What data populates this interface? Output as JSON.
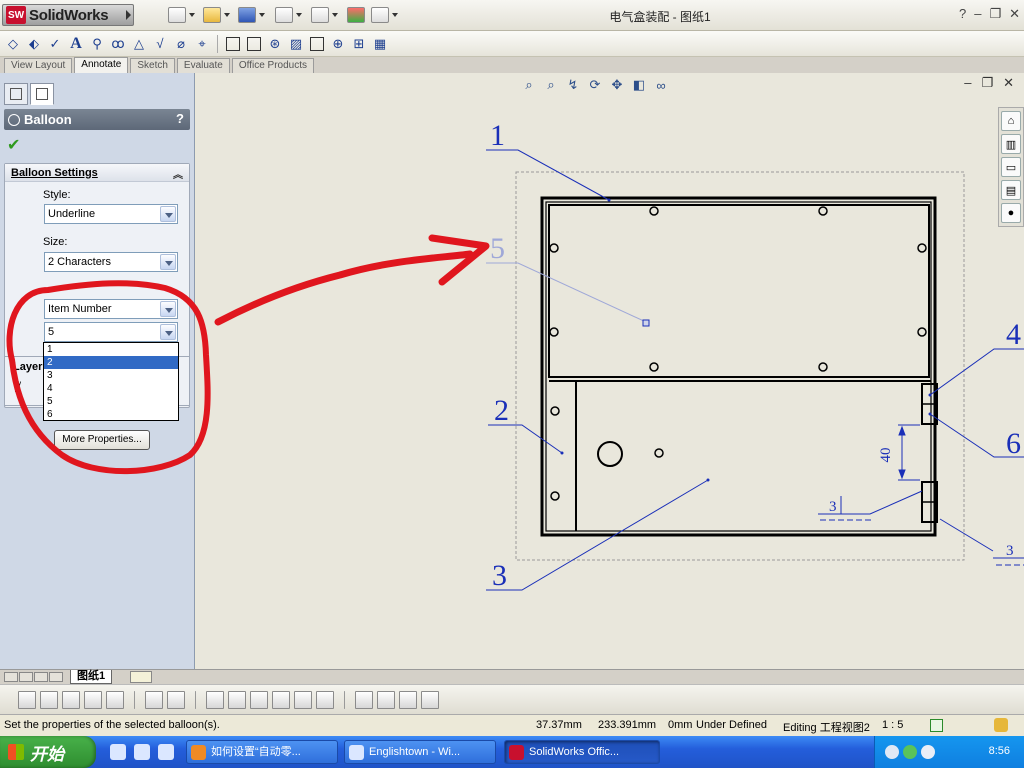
{
  "app": {
    "brand": "SolidWorks",
    "document_title": "电气盒装配 - 图纸1",
    "help": "?",
    "minimize": "–",
    "restore": "❐",
    "close": "✕"
  },
  "command_tabs": [
    "View Layout",
    "Annotate",
    "Sketch",
    "Evaluate",
    "Office Products"
  ],
  "property_manager": {
    "title": "Balloon",
    "help": "?",
    "confirm": "✔",
    "group_title": "Balloon Settings",
    "style_label": "Style:",
    "style_value": "Underline",
    "size_label": "Size:",
    "size_value": "2 Characters",
    "text_value": "Item Number",
    "number_value": "5",
    "dropdown_options": [
      "1",
      "2",
      "3",
      "4",
      "5",
      "6"
    ],
    "selected_option": "2",
    "layer_label": "Layer",
    "more_button": "More Properties..."
  },
  "drawing": {
    "balloons": [
      "1",
      "5",
      "2",
      "3",
      "4",
      "6"
    ],
    "dimension": "40",
    "weld_labels": [
      "3",
      "3"
    ]
  },
  "sheet_tab": "图纸1",
  "status": {
    "message": "Set the properties of the selected balloon(s).",
    "x": "37.37mm",
    "y": "233.391mm",
    "z": "0mm",
    "state": "Under Defined",
    "editing": "Editing 工程视图2",
    "scale": "1 : 5"
  },
  "taskbar": {
    "start": "开始",
    "tasks": [
      "如何设置“自动零...",
      "Englishtown - Wi...",
      "SolidWorks Offic..."
    ],
    "clock": "8:56"
  },
  "colors": {
    "annotation_red": "#e0161e",
    "leader_blue": "#1a2fb8",
    "pm_header": "#5d6878"
  }
}
